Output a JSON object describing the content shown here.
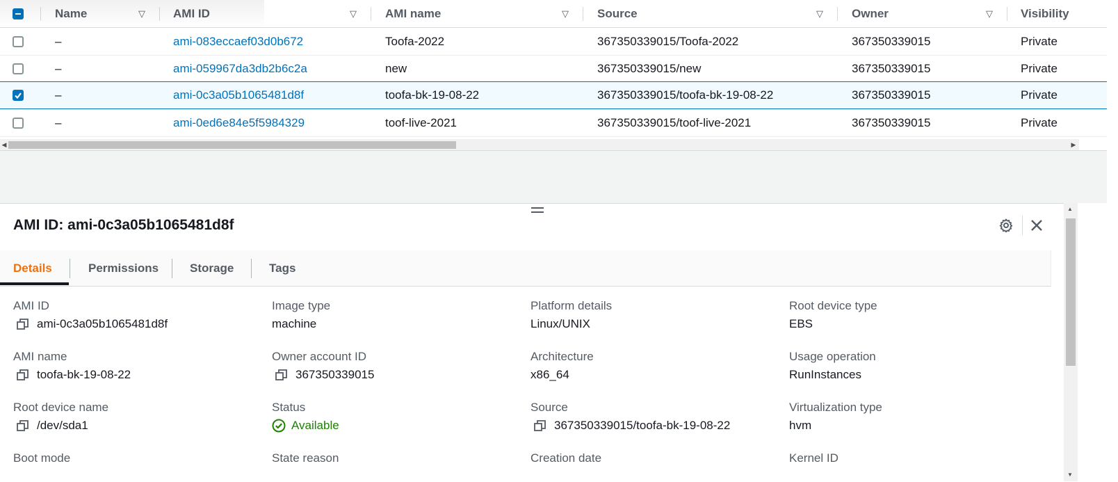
{
  "table": {
    "columns": [
      {
        "label": "Name"
      },
      {
        "label": "AMI ID"
      },
      {
        "label": "AMI name"
      },
      {
        "label": "Source"
      },
      {
        "label": "Owner"
      },
      {
        "label": "Visibility"
      }
    ],
    "rows": [
      {
        "name": "–",
        "ami_id": "ami-083eccaef03d0b672",
        "ami_name": "Toofa-2022",
        "source": "367350339015/Toofa-2022",
        "owner": "367350339015",
        "visibility": "Private",
        "selected": false
      },
      {
        "name": "–",
        "ami_id": "ami-059967da3db2b6c2a",
        "ami_name": "new",
        "source": "367350339015/new",
        "owner": "367350339015",
        "visibility": "Private",
        "selected": false
      },
      {
        "name": "–",
        "ami_id": "ami-0c3a05b1065481d8f",
        "ami_name": "toofa-bk-19-08-22",
        "source": "367350339015/toofa-bk-19-08-22",
        "owner": "367350339015",
        "visibility": "Private",
        "selected": true
      },
      {
        "name": "–",
        "ami_id": "ami-0ed6e84e5f5984329",
        "ami_name": "toof-live-2021",
        "source": "367350339015/toof-live-2021",
        "owner": "367350339015",
        "visibility": "Private",
        "selected": false
      }
    ]
  },
  "panel": {
    "title": "AMI ID: ami-0c3a05b1065481d8f",
    "tabs": [
      "Details",
      "Permissions",
      "Storage",
      "Tags"
    ],
    "active_tab": "Details",
    "fields": {
      "ami_id": {
        "label": "AMI ID",
        "value": "ami-0c3a05b1065481d8f"
      },
      "image_type": {
        "label": "Image type",
        "value": "machine"
      },
      "platform_details": {
        "label": "Platform details",
        "value": "Linux/UNIX"
      },
      "root_device_type": {
        "label": "Root device type",
        "value": "EBS"
      },
      "ami_name": {
        "label": "AMI name",
        "value": "toofa-bk-19-08-22"
      },
      "owner_account_id": {
        "label": "Owner account ID",
        "value": "367350339015"
      },
      "architecture": {
        "label": "Architecture",
        "value": "x86_64"
      },
      "usage_operation": {
        "label": "Usage operation",
        "value": "RunInstances"
      },
      "root_device_name": {
        "label": "Root device name",
        "value": "/dev/sda1"
      },
      "status": {
        "label": "Status",
        "value": "Available"
      },
      "source": {
        "label": "Source",
        "value": "367350339015/toofa-bk-19-08-22"
      },
      "virtualization_type": {
        "label": "Virtualization type",
        "value": "hvm"
      },
      "boot_mode": {
        "label": "Boot mode"
      },
      "state_reason": {
        "label": "State reason"
      },
      "creation_date": {
        "label": "Creation date"
      },
      "kernel_id": {
        "label": "Kernel ID"
      }
    }
  },
  "icons": {
    "settings": "gear-icon",
    "close": "close-icon",
    "copy": "copy-icon",
    "status": "check-circle-icon",
    "sort": "caret-down-icon"
  },
  "colors": {
    "link": "#0073bb",
    "active_tab": "#ec7211",
    "status_ok": "#1d8102",
    "selected_row_bg": "#f1faff",
    "checkbox_checked": "#0073bb"
  }
}
